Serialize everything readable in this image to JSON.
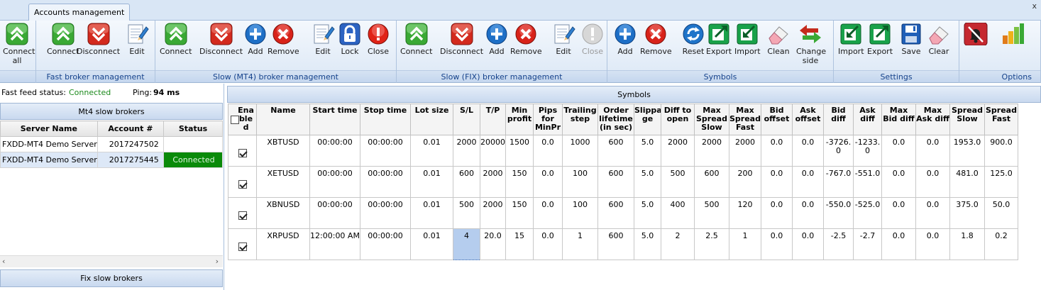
{
  "tabs": {
    "active": "Accounts management",
    "close_glyph": "x"
  },
  "ribbon": {
    "groups": [
      {
        "label": "",
        "buttons": [
          {
            "label": "Connect all",
            "icon": "connect-icon"
          }
        ]
      },
      {
        "label": "Fast broker management",
        "buttons": [
          {
            "label": "Connect",
            "icon": "connect-icon"
          },
          {
            "label": "Disconnect",
            "icon": "disconnect-icon"
          },
          {
            "label": "Edit",
            "icon": "edit-icon"
          }
        ]
      },
      {
        "label": "Slow (MT4)  broker management",
        "buttons": [
          {
            "label": "Connect",
            "icon": "connect-icon"
          },
          {
            "label": "Disconnect",
            "icon": "disconnect-icon"
          },
          {
            "label": "Add",
            "icon": "add-icon"
          },
          {
            "label": "Remove",
            "icon": "remove-icon"
          },
          {
            "label": "Edit",
            "icon": "edit-icon"
          },
          {
            "label": "Lock",
            "icon": "lock-icon"
          },
          {
            "label": "Close",
            "icon": "close-icon"
          }
        ]
      },
      {
        "label": "Slow (FIX) broker management",
        "buttons": [
          {
            "label": "Connect",
            "icon": "connect-icon"
          },
          {
            "label": "Disconnect",
            "icon": "disconnect-icon"
          },
          {
            "label": "Add",
            "icon": "add-icon"
          },
          {
            "label": "Remove",
            "icon": "remove-icon"
          },
          {
            "label": "Edit",
            "icon": "edit-icon"
          },
          {
            "label": "Close",
            "icon": "close-icon",
            "disabled": true
          }
        ]
      },
      {
        "label": "Symbols",
        "buttons": [
          {
            "label": "Add",
            "icon": "add-icon"
          },
          {
            "label": "Remove",
            "icon": "remove-icon"
          },
          {
            "label": "Reset",
            "icon": "reset-icon"
          },
          {
            "label": "Export",
            "icon": "export-icon"
          },
          {
            "label": "Import",
            "icon": "import-icon"
          },
          {
            "label": "Clean",
            "icon": "eraser-icon"
          },
          {
            "label": "Change side",
            "icon": "swap-arrows-icon"
          }
        ]
      },
      {
        "label": "Settings",
        "buttons": [
          {
            "label": "Import",
            "icon": "import-icon"
          },
          {
            "label": "Export",
            "icon": "export-icon"
          },
          {
            "label": "Save",
            "icon": "save-icon"
          },
          {
            "label": "Clear",
            "icon": "eraser-icon"
          }
        ]
      },
      {
        "label": "Options",
        "buttons": [
          {
            "label": "",
            "icon": "alarm-off-icon"
          },
          {
            "label": "",
            "icon": "signal-bars-icon"
          }
        ]
      }
    ]
  },
  "feed": {
    "status_label": "Fast feed status:",
    "status_value": "Connected",
    "ping_label": "Ping:",
    "ping_value": "94 ms"
  },
  "mt4_panel": {
    "title": "Mt4 slow brokers",
    "columns": [
      "Server Name",
      "Account #",
      "Status"
    ],
    "rows": [
      {
        "server": "FXDD-MT4 Demo Server",
        "account": "2017247502",
        "status": ""
      },
      {
        "server": "FXDD-MT4 Demo Server",
        "account": "2017275445",
        "status": "Connected"
      }
    ]
  },
  "fix_panel": {
    "title": "Fix slow brokers"
  },
  "symbols": {
    "title": "Symbols",
    "columns": [
      "Ena\nble\nd",
      "Name",
      "Start time",
      "Stop time",
      "Lot size",
      "S/L",
      "T/P",
      "Min\nprofit",
      "Pips\nfor\nMinPr",
      "Trailing\nstep",
      "Order\nlifetime\n(in sec)",
      "Slippa\nge",
      "Diff to\nopen",
      "Max\nSpread\nSlow",
      "Max\nSpread\nFast",
      "Bid\noffset",
      "Ask\noffset",
      "Bid\ndiff",
      "Ask\ndiff",
      "Max\nBid diff",
      "Max\nAsk diff",
      "Spread\nSlow",
      "Spread\nFast"
    ],
    "rows": [
      [
        "XBTUSD",
        "00:00:00",
        "00:00:00",
        "0.01",
        "2000",
        "20000",
        "1500",
        "0.0",
        "1000",
        "600",
        "5.0",
        "2000",
        "2000",
        "2000",
        "0.0",
        "0.0",
        "-3726.\n0",
        "-1233.\n0",
        "0.0",
        "0.0",
        "1953.0",
        "900.0"
      ],
      [
        "XETUSD",
        "00:00:00",
        "00:00:00",
        "0.01",
        "600",
        "2000",
        "150",
        "0.0",
        "100",
        "600",
        "5.0",
        "500",
        "600",
        "200",
        "0.0",
        "0.0",
        "-767.0",
        "-551.0",
        "0.0",
        "0.0",
        "481.0",
        "125.0"
      ],
      [
        "XBNUSD",
        "00:00:00",
        "00:00:00",
        "0.01",
        "500",
        "2000",
        "150",
        "0.0",
        "100",
        "600",
        "5.0",
        "400",
        "500",
        "120",
        "0.0",
        "0.0",
        "-550.0",
        "-525.0",
        "0.0",
        "0.0",
        "375.0",
        "50.0"
      ],
      [
        "XRPUSD",
        "12:00:00 AM",
        "00:00:00",
        "0.01",
        "4",
        "20.0",
        "15",
        "0.0",
        "1",
        "600",
        "5.0",
        "2",
        "2.5",
        "1",
        "0.0",
        "0.0",
        "-2.5",
        "-2.7",
        "0.0",
        "0.0",
        "1.8",
        "0.2"
      ]
    ],
    "enabled": [
      true,
      true,
      true,
      true
    ]
  },
  "colors": {
    "connected_green": "#0a8a0a",
    "ribbon_blue": "#15428b"
  }
}
